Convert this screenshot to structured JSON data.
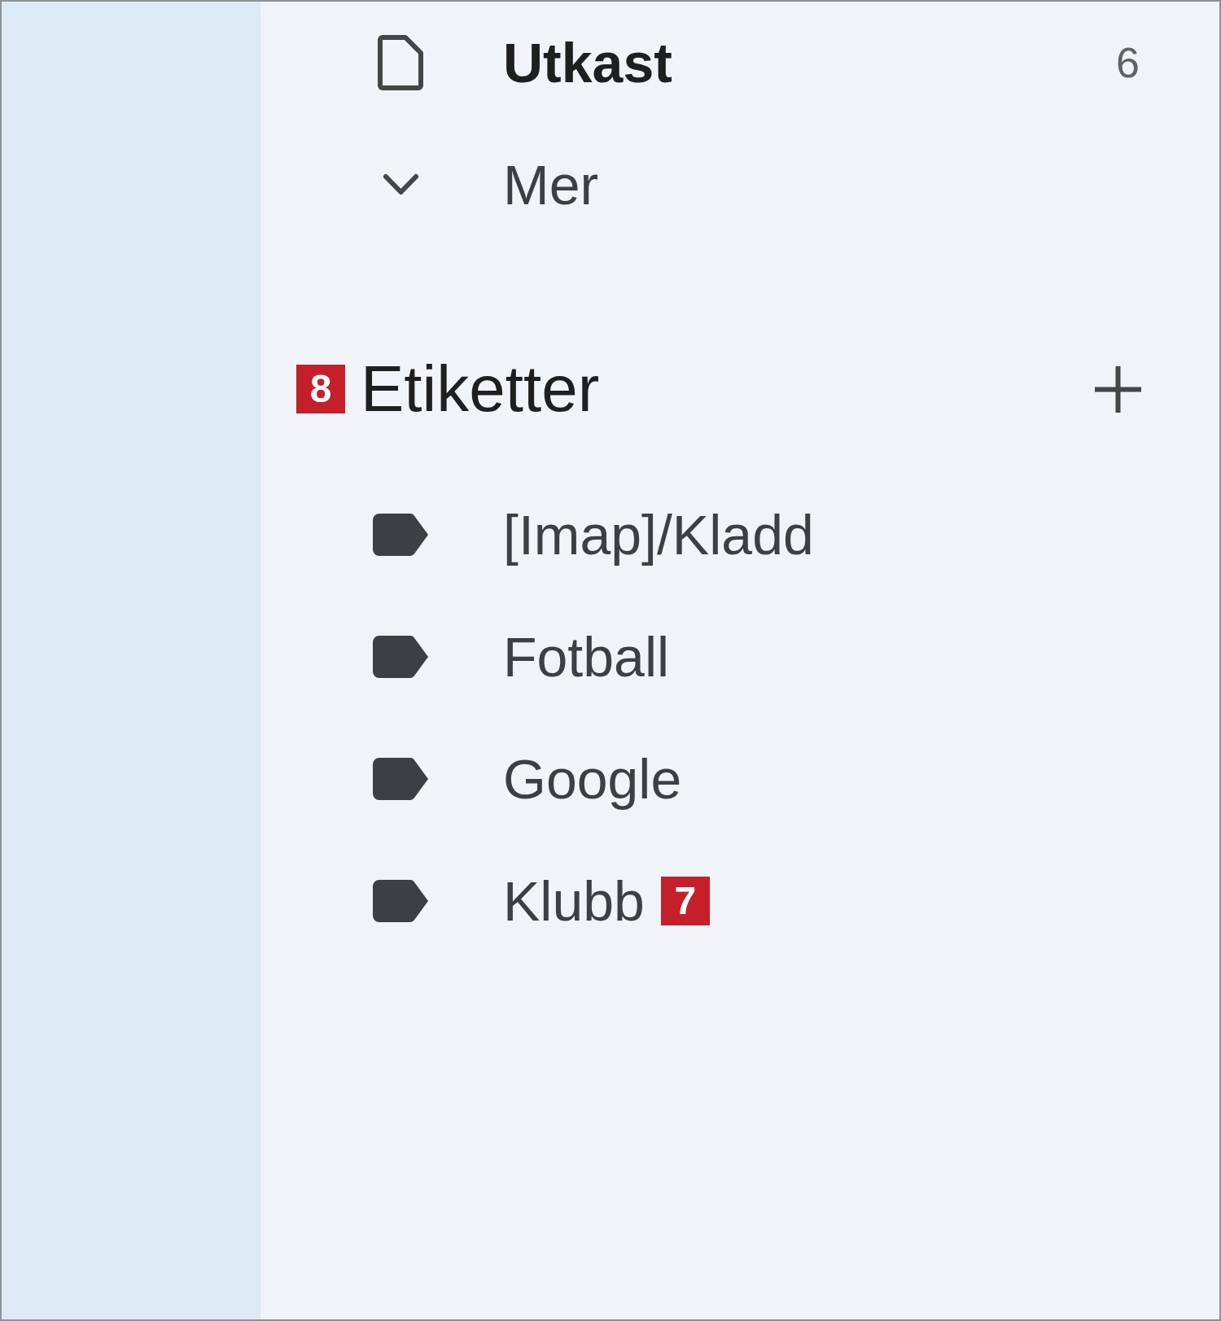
{
  "folders": [
    {
      "kind": "folder",
      "label": "Utkast",
      "count": "6",
      "unread": true
    },
    {
      "kind": "more",
      "label": "Mer",
      "expanded": false
    }
  ],
  "labels_section": {
    "title": "Etiketter",
    "callout": "8"
  },
  "labels": [
    {
      "name": "[Imap]/Kladd"
    },
    {
      "name": "Fotball"
    },
    {
      "name": "Google"
    },
    {
      "name": "Klubb",
      "callout": "7"
    }
  ]
}
